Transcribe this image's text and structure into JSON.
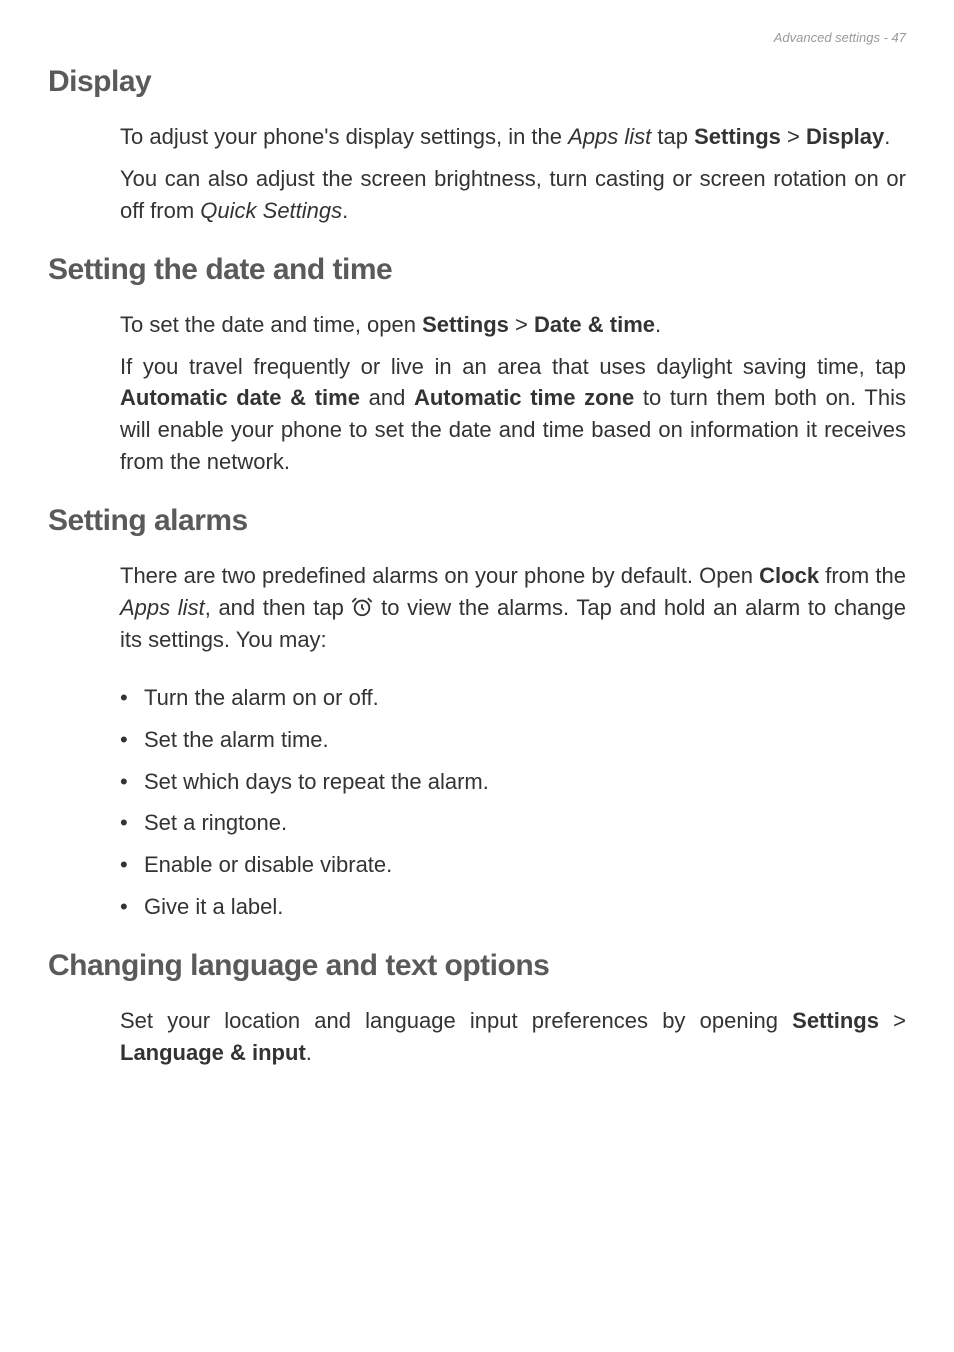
{
  "header": {
    "text": "Advanced settings - 47"
  },
  "sections": {
    "display": {
      "heading": "Display",
      "p1_a": "To adjust your phone's display settings, in the ",
      "p1_b": "Apps list",
      "p1_c": " tap ",
      "p1_d": "Settings",
      "p1_e": " > ",
      "p1_f": "Display",
      "p1_g": ".",
      "p2_a": "You can also adjust the screen brightness, turn casting or screen rotation on or off from ",
      "p2_b": "Quick Settings",
      "p2_c": "."
    },
    "datetime": {
      "heading": "Setting the date and time",
      "p1_a": "To set the date and time, open ",
      "p1_b": "Settings",
      "p1_c": " > ",
      "p1_d": "Date & time",
      "p1_e": ".",
      "p2_a": "If you travel frequently or live in an area that uses daylight saving time, tap ",
      "p2_b": "Automatic date & time",
      "p2_c": " and ",
      "p2_d": "Automatic time zone",
      "p2_e": " to turn them both on. This will enable your phone to set the date and time based on information it receives from the network."
    },
    "alarms": {
      "heading": "Setting alarms",
      "p1_a": "There are two predefined alarms on your phone by default. Open ",
      "p1_b": "Clock",
      "p1_c": " from the ",
      "p1_d": "Apps list",
      "p1_e": ", and then tap ",
      "p1_f": " to view the alarms. Tap and hold an alarm to change its settings. You may:",
      "bullets": {
        "0": "Turn the alarm on or off.",
        "1": "Set the alarm time.",
        "2": "Set which days to repeat the alarm.",
        "3": "Set a ringtone.",
        "4": "Enable or disable vibrate.",
        "5": "Give it a label."
      }
    },
    "language": {
      "heading": "Changing language and text options",
      "p1_a": "Set your location and language input preferences by opening ",
      "p1_b": "Settings",
      "p1_c": " > ",
      "p1_d": "Language & input",
      "p1_e": "."
    }
  }
}
